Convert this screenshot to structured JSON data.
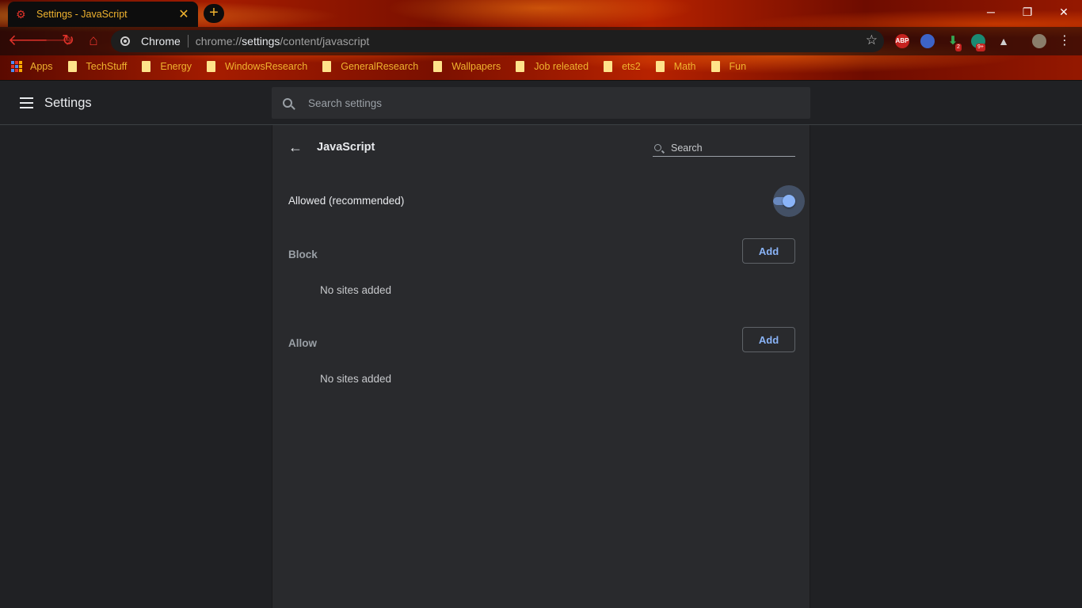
{
  "tab": {
    "title": "Settings - JavaScript",
    "close": "✕"
  },
  "window": {
    "new_tab": "+",
    "minimize": "─",
    "maximize": "❐",
    "close": "✕"
  },
  "toolbar": {
    "omnibox_label": "Chrome",
    "url_prefix": "chrome://",
    "url_host": "settings",
    "url_path": "/content/javascript",
    "extensions": [
      {
        "name": "ABP",
        "badge": ""
      },
      {
        "name": "",
        "badge": ""
      },
      {
        "name": "",
        "badge": "2"
      },
      {
        "name": "",
        "badge": "9+"
      },
      {
        "name": "",
        "badge": ""
      }
    ]
  },
  "bookmarks": {
    "apps": "Apps",
    "items": [
      "TechStuff",
      "Energy",
      "WindowsResearch",
      "GeneralResearch",
      "Wallpapers",
      "Job releated",
      "ets2",
      "Math",
      "Fun"
    ]
  },
  "header": {
    "title": "Settings",
    "search_placeholder": "Search settings"
  },
  "page": {
    "title": "JavaScript",
    "search_placeholder": "Search",
    "allowed_label": "Allowed (recommended)",
    "allowed_enabled": true,
    "block": {
      "title": "Block",
      "add_label": "Add",
      "empty": "No sites added"
    },
    "allow": {
      "title": "Allow",
      "add_label": "Add",
      "empty": "No sites added"
    }
  },
  "colors": {
    "accent": "#8ab4f8",
    "tab_text": "#f0b32f",
    "nav_icon": "#e0322a",
    "page_bg": "#202124",
    "card_bg": "#292a2d"
  }
}
